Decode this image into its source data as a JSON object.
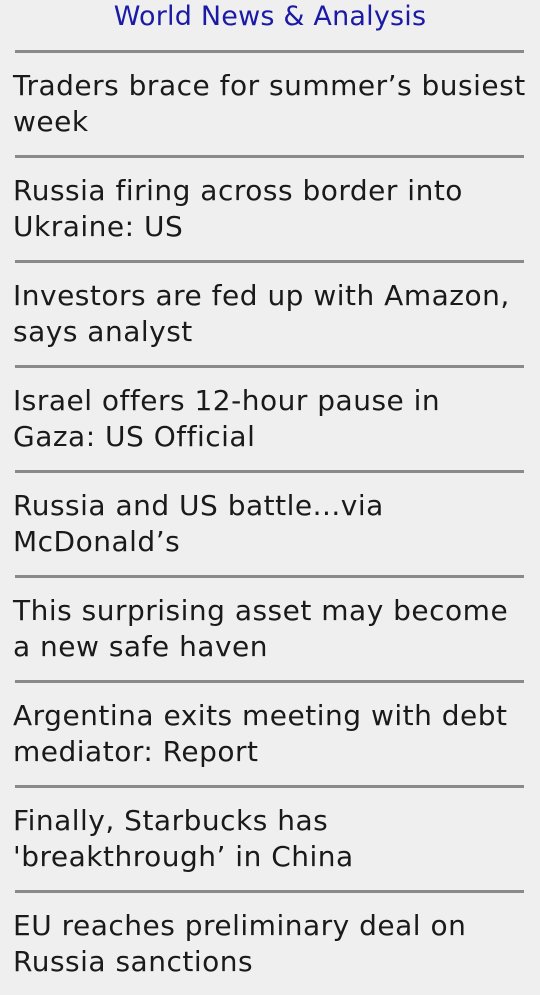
{
  "header": {
    "title": "World News & Analysis"
  },
  "news": {
    "items": [
      {
        "headline": "Traders brace for summer’s busiest week"
      },
      {
        "headline": "Russia firing across border into Ukraine: US"
      },
      {
        "headline": "Investors are fed up with Amazon, says analyst"
      },
      {
        "headline": "Israel offers 12-hour pause in Gaza: US Official"
      },
      {
        "headline": "Russia and US battle...via McDonald’s"
      },
      {
        "headline": "This surprising asset may become a new safe haven"
      },
      {
        "headline": "Argentina exits meeting with debt mediator: Report"
      },
      {
        "headline": "Finally, Starbucks has 'breakthrough’ in China"
      },
      {
        "headline": "EU reaches preliminary deal on Russia sanctions"
      }
    ]
  },
  "colors": {
    "background": "#efefef",
    "header_text": "#1a1aa6",
    "headline_text": "#1a1a1a",
    "divider": "#8a8a8a"
  }
}
